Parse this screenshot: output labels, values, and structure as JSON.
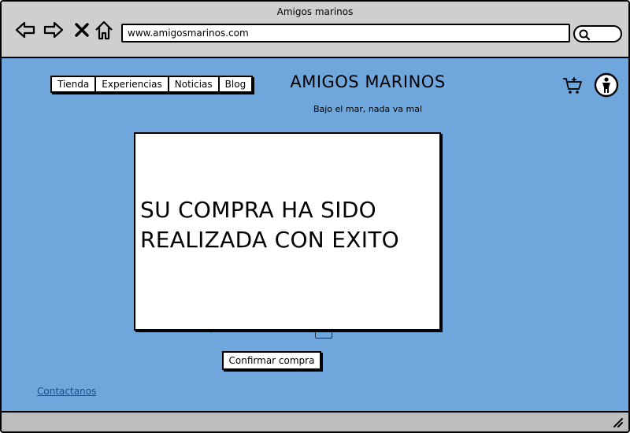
{
  "browser": {
    "window_title": "Amigos marinos",
    "url": "www.amigosmarinos.com",
    "icons": [
      "back-arrow-icon",
      "forward-arrow-icon",
      "close-x-icon",
      "home-icon",
      "search-icon",
      "resize-grip-icon"
    ]
  },
  "site": {
    "nav": [
      "Tienda",
      "Experiencias",
      "Noticias",
      "Blog"
    ],
    "brand": "AMIGOS MARINOS",
    "tagline": "Bajo el mar, nada va mal",
    "header_icons": [
      "cart-icon",
      "accessibility-icon"
    ]
  },
  "modal": {
    "message_line1": "SU COMPRA HA SIDO",
    "message_line2": "REALIZADA CON EXITO"
  },
  "main": {
    "confirm_label": "Confirmar compra",
    "contact_label": "Contactanos"
  },
  "colors": {
    "page_background": "#6fa7dc",
    "chrome": "#cfcfcf",
    "link": "#1a4f8a"
  }
}
